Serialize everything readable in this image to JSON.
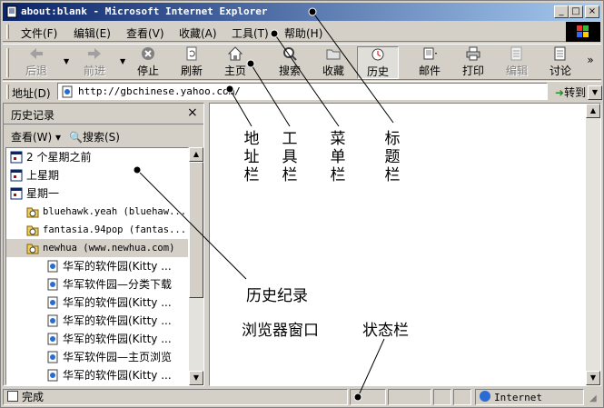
{
  "window": {
    "title": "about:blank - Microsoft Internet Explorer",
    "min": "_",
    "max": "□",
    "close": "×"
  },
  "menu": {
    "items": [
      "文件(F)",
      "编辑(E)",
      "查看(V)",
      "收藏(A)",
      "工具(T)",
      "帮助(H)"
    ]
  },
  "toolbar": {
    "back": "后退",
    "forward": "前进",
    "stop": "停止",
    "refresh": "刷新",
    "home": "主页",
    "search": "搜索",
    "favorites": "收藏",
    "history": "历史",
    "mail": "邮件",
    "print": "打印",
    "edit": "编辑",
    "discuss": "讨论"
  },
  "address": {
    "label": "地址(D)",
    "value": "http://gbchinese.yahoo.com/",
    "go": "转到"
  },
  "history": {
    "title": "历史记录",
    "close": "×",
    "view": "查看(W) ▾",
    "search": "搜索(S)",
    "items": [
      {
        "text": "2 个星期之前",
        "type": "week"
      },
      {
        "text": "上星期",
        "type": "week"
      },
      {
        "text": "星期一",
        "type": "week"
      },
      {
        "text": "bluehawk.yeah (bluehaw...",
        "type": "folder"
      },
      {
        "text": "fantasia.94pop (fantas...",
        "type": "folder"
      },
      {
        "text": "newhua (www.newhua.com)",
        "type": "folder"
      },
      {
        "text": "华军的软件园(Kitty ...",
        "type": "page"
      },
      {
        "text": "华军软件园—分类下载",
        "type": "page"
      },
      {
        "text": "华军的软件园(Kitty ...",
        "type": "page"
      },
      {
        "text": "华军的软件园(Kitty ...",
        "type": "page"
      },
      {
        "text": "华军的软件园(Kitty ...",
        "type": "page"
      },
      {
        "text": "华军软件园—主页浏览",
        "type": "page"
      },
      {
        "text": "华军的软件园(Kitty ...",
        "type": "page"
      }
    ]
  },
  "status": {
    "text": "完成",
    "zone": "Internet"
  },
  "annotations": {
    "address_bar": "地址栏",
    "toolbar": "工具栏",
    "menu_bar": "菜单栏",
    "title_bar": "标题栏",
    "history": "历史纪录",
    "browser_window": "浏览器窗口",
    "status_bar": "状态栏"
  },
  "colors": {
    "title_start": "#0a246a",
    "title_end": "#a6caf0",
    "face": "#d4d0c8"
  }
}
